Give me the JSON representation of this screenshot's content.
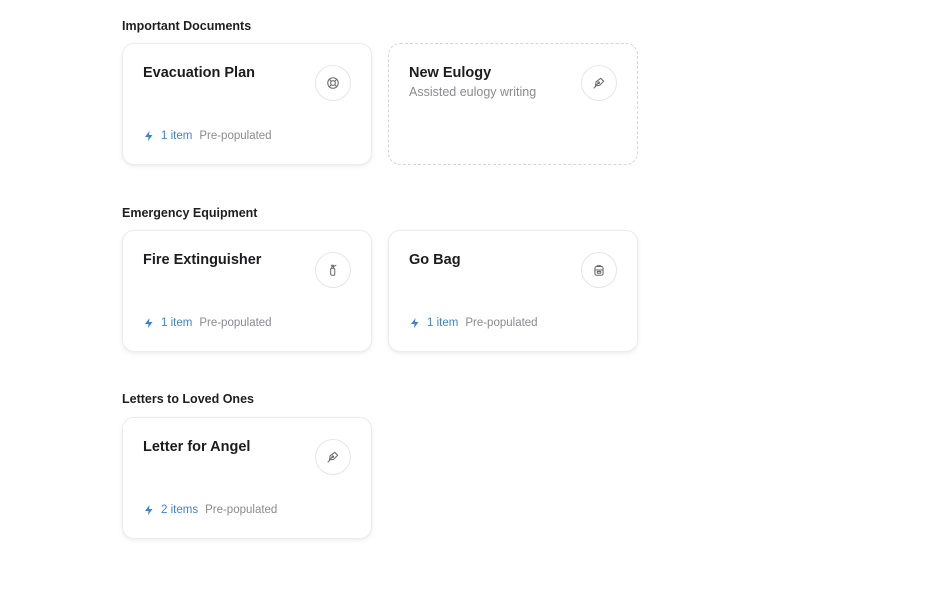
{
  "colors": {
    "accent": "#3b82d6",
    "muted_text": "#8a8a90",
    "border": "#ececee"
  },
  "sections": [
    {
      "title": "Important Documents",
      "cards": [
        {
          "title": "Evacuation Plan",
          "icon": "life-buoy-icon",
          "count": "1 item",
          "status": "Pre-populated"
        },
        {
          "title": "New Eulogy",
          "subtitle": "Assisted eulogy writing",
          "icon": "pen-nib-icon"
        }
      ]
    },
    {
      "title": "Emergency Equipment",
      "cards": [
        {
          "title": "Fire Extinguisher",
          "icon": "fire-extinguisher-icon",
          "count": "1 item",
          "status": "Pre-populated"
        },
        {
          "title": "Go Bag",
          "icon": "backpack-icon",
          "count": "1 item",
          "status": "Pre-populated"
        }
      ]
    },
    {
      "title": "Letters to Loved Ones",
      "cards": [
        {
          "title": "Letter for Angel",
          "icon": "pen-nib-icon",
          "count": "2 items",
          "status": "Pre-populated"
        }
      ]
    }
  ]
}
